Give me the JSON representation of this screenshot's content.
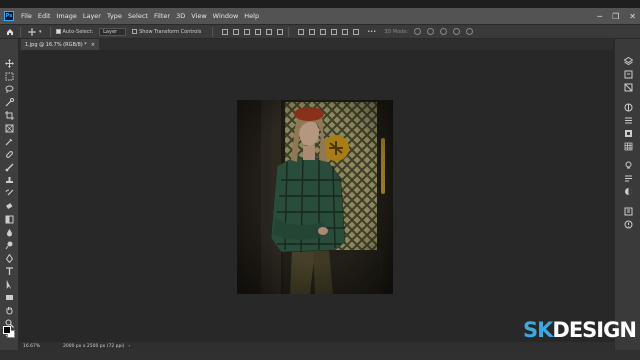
{
  "menubar": {
    "logo": "Ps",
    "items": [
      "File",
      "Edit",
      "Image",
      "Layer",
      "Type",
      "Select",
      "Filter",
      "3D",
      "View",
      "Window",
      "Help"
    ]
  },
  "options": {
    "auto_select_label": "Auto-Select:",
    "layer_select": "Layer",
    "show_transform_label": "Show Transform Controls",
    "mode_3d_label": "3D Mode:"
  },
  "document": {
    "tab_title": "1.jpg @ 16.7% (RGB/8) *",
    "tab_close": "×"
  },
  "status": {
    "zoom": "16.67%",
    "doc_info": "2000 px x 2500 px (72 ppi)"
  },
  "watermark": {
    "part1": "SK",
    "part2": "DESIGN"
  },
  "colors": {
    "accent": "#31a8ff",
    "watermark_sk": "#3ba8e0"
  }
}
